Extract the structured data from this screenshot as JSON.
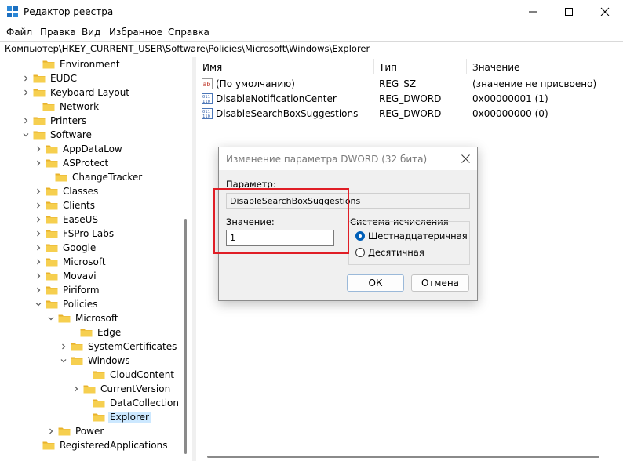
{
  "window": {
    "title": "Редактор реестра"
  },
  "menu": [
    "Файл",
    "Правка",
    "Вид",
    "Избранное",
    "Справка"
  ],
  "address": "Компьютер\\HKEY_CURRENT_USER\\Software\\Policies\\Microsoft\\Windows\\Explorer",
  "tree": [
    {
      "label": "Environment"
    },
    {
      "label": "EUDC"
    },
    {
      "label": "Keyboard Layout"
    },
    {
      "label": "Network"
    },
    {
      "label": "Printers"
    },
    {
      "label": "Software"
    },
    {
      "label": "AppDataLow"
    },
    {
      "label": "ASProtect"
    },
    {
      "label": "ChangeTracker"
    },
    {
      "label": "Classes"
    },
    {
      "label": "Clients"
    },
    {
      "label": "EaseUS"
    },
    {
      "label": "FSPro Labs"
    },
    {
      "label": "Google"
    },
    {
      "label": "Microsoft"
    },
    {
      "label": "Movavi"
    },
    {
      "label": "Piriform"
    },
    {
      "label": "Policies"
    },
    {
      "label": "Microsoft"
    },
    {
      "label": "Edge"
    },
    {
      "label": "SystemCertificates"
    },
    {
      "label": "Windows"
    },
    {
      "label": "CloudContent"
    },
    {
      "label": "CurrentVersion"
    },
    {
      "label": "DataCollection"
    },
    {
      "label": "Explorer"
    },
    {
      "label": "Power"
    },
    {
      "label": "RegisteredApplications"
    }
  ],
  "list": {
    "headers": {
      "name": "Имя",
      "type": "Тип",
      "value": "Значение"
    },
    "rows": [
      {
        "name": "(По умолчанию)",
        "type": "REG_SZ",
        "value": "(значение не присвоено)",
        "icon": "string-value-icon"
      },
      {
        "name": "DisableNotificationCenter",
        "type": "REG_DWORD",
        "value": "0x00000001 (1)",
        "icon": "dword-value-icon"
      },
      {
        "name": "DisableSearchBoxSuggestions",
        "type": "REG_DWORD",
        "value": "0x00000000 (0)",
        "icon": "dword-value-icon"
      }
    ]
  },
  "dialog": {
    "title": "Изменение параметра DWORD (32 бита)",
    "param_label": "Параметр:",
    "param_value": "DisableSearchBoxSuggestions",
    "value_label": "Значение:",
    "value": "1",
    "base_label": "Система исчисления",
    "hex_label": "Шестнадцатеричная",
    "dec_label": "Десятичная",
    "ok_label": "ОК",
    "cancel_label": "Отмена"
  },
  "colors": {
    "accent": "#005fb8",
    "highlight": "#e01e26",
    "folder": "#f3c342",
    "selection": "#cce8ff"
  }
}
